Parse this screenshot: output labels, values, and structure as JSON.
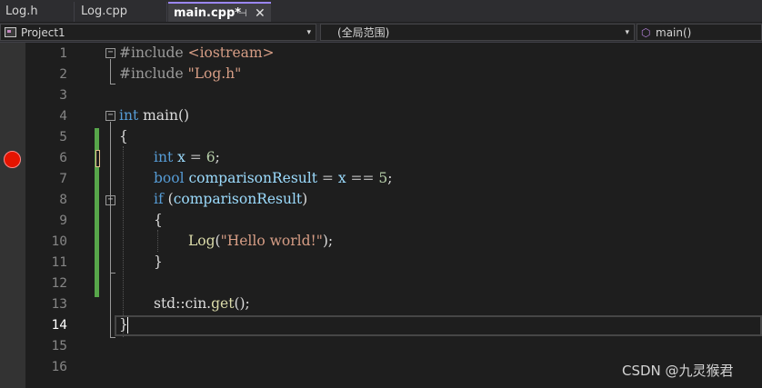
{
  "tabs": [
    {
      "label": "Log.h"
    },
    {
      "label": "Log.cpp"
    },
    {
      "label": "main.cpp*",
      "pin": "⊣",
      "close": "✕"
    }
  ],
  "navbar": {
    "project": "Project1",
    "scope": "(全局范围)",
    "member": "main()",
    "arrow": "▾"
  },
  "line_numbers": [
    "1",
    "2",
    "3",
    "4",
    "5",
    "6",
    "7",
    "8",
    "9",
    "10",
    "11",
    "12",
    "13",
    "14",
    "15",
    "16"
  ],
  "current_line": "14",
  "code": {
    "l1_directive": "#include ",
    "l1_header": "<iostream>",
    "l2_directive": "#include ",
    "l2_header": "\"Log.h\"",
    "l4_type": "int",
    "l4_name": " main()",
    "l5_brace": "{",
    "l6_type": "int",
    "l6_var": " x ",
    "l6_op": "= ",
    "l6_num": "6",
    "l6_end": ";",
    "l7_type": "bool",
    "l7_var": " comparisonResult ",
    "l7_op": "= ",
    "l7_x": "x",
    "l7_eq": " == ",
    "l7_num": "5",
    "l7_end": ";",
    "l8_kw": "if",
    "l8_open": " (",
    "l8_var": "comparisonResult",
    "l8_close": ")",
    "l9_brace": "{",
    "l10_fn": "Log",
    "l10_open": "(",
    "l10_str": "\"Hello world!\"",
    "l10_close": ");",
    "l11_brace": "}",
    "l13_ns": "std::cin.",
    "l13_fn": "get",
    "l13_end": "();",
    "l14_brace": "}"
  },
  "fold_glyph": "−",
  "watermark": "CSDN @九灵猴君",
  "colors": {
    "keyword": "#569cd6",
    "string": "#d69d85",
    "number": "#b5cea8",
    "variable": "#9cdcfe",
    "function": "#dcdcaa",
    "breakpoint": "#e51400",
    "change_bar": "#57a64a",
    "active_tab_accent": "#9b87f5"
  }
}
